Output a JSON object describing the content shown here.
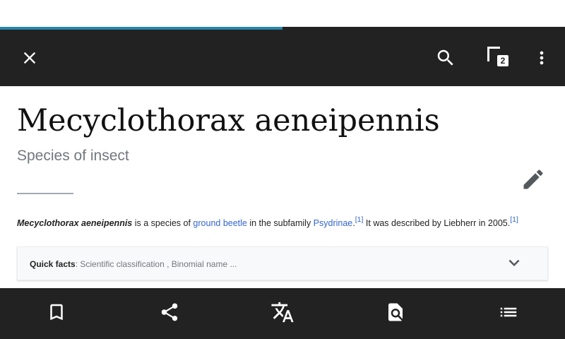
{
  "colors": {
    "toolbar_bg": "#222222",
    "progress": "#2a86a8",
    "link": "#3366cc",
    "muted_text": "#72777d",
    "body_text": "#222222"
  },
  "load_progress": 0.5,
  "toolbar": {
    "close_icon": "close-icon",
    "search_icon": "search-icon",
    "tabs_count": "2",
    "overflow_icon": "more-vertical-icon"
  },
  "article": {
    "title": "Mecyclothorax aeneipennis",
    "description": "Species of insect",
    "intro": {
      "subject": "Mecyclothorax aeneipennis",
      "t1": " is a species of ",
      "link1": "ground beetle",
      "t2": " in the subfamily ",
      "link2": "Psydrinae",
      "t3": ".",
      "ref1": "[1]",
      "t4": " It was described by Liebherr in 2005.",
      "ref2": "[1]"
    },
    "quick_facts": {
      "label": "Quick facts",
      "summary": ": Scientific classification , Binomial name ..."
    }
  },
  "bottom_bar": {
    "icons": [
      "bookmark-icon",
      "share-icon",
      "translate-icon",
      "find-in-page-icon",
      "contents-icon"
    ]
  }
}
